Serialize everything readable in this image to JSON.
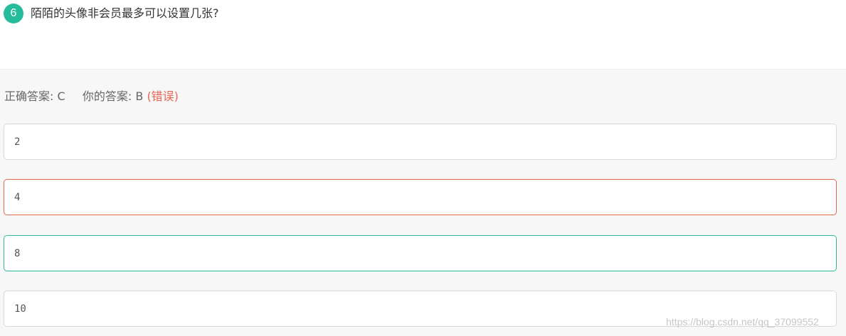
{
  "question": {
    "number": "6",
    "text": "陌陌的头像非会员最多可以设置几张?"
  },
  "result": {
    "correct_label": "正确答案:",
    "correct_value": "C",
    "your_label": "你的答案:",
    "your_value": "B",
    "status": "(错误)"
  },
  "options": [
    {
      "value": "2",
      "state": "normal"
    },
    {
      "value": "4",
      "state": "wrong"
    },
    {
      "value": "8",
      "state": "correct"
    },
    {
      "value": "10",
      "state": "normal"
    }
  ],
  "watermark": "https://blog.csdn.net/qq_37099552",
  "colors": {
    "accent_green": "#25bb9b",
    "error_red": "#e8664e",
    "panel_bg": "#f7f7f7"
  }
}
